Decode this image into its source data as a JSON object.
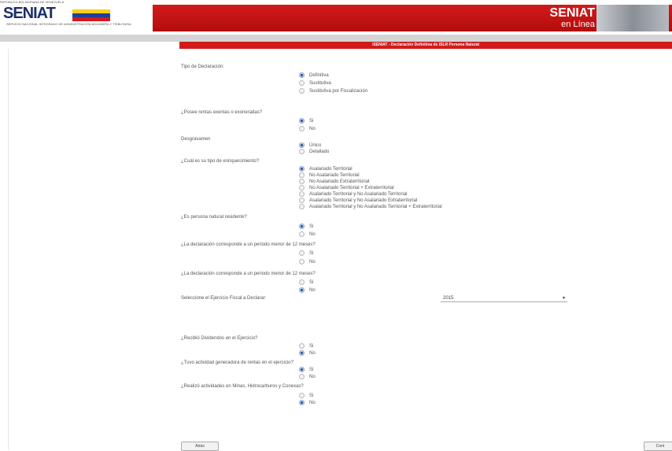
{
  "header": {
    "toptext": "REPÚBLICA BOLIVARIANA DE VENEZUELA",
    "logo": "SENIAT",
    "logo_sub": "SERVICIO NACIONAL INTEGRADO DE ADMINISTRACIÓN ADUANERA Y TRIBUTARIA",
    "brand_line1": "SENIAT",
    "brand_line2": "en Línea"
  },
  "title": "iSENIAT - Declaración Definitiva de ISLR Persona Natural",
  "questions": {
    "tipo": {
      "label": "Tipo de Declaración:",
      "options": [
        "Definitiva",
        "Sustitutiva",
        "Sustitutiva por Fiscalización"
      ],
      "selected": 0
    },
    "exentas": {
      "label": "¿Posee rentas exentas o exoneradas?",
      "options": [
        "Si",
        "No"
      ],
      "selected": 0
    },
    "desgravamen": {
      "label": "Desgravamen",
      "options": [
        "Único",
        "Detallado"
      ],
      "selected": 0
    },
    "enriquecimiento": {
      "label": "¿Cuál es su tipo de enriquecimiento?",
      "options": [
        "Asalariado Territorial",
        "No Asalariado Territorial",
        "No Asalariado Extraterritorial",
        "No Asalariado Territorial + Extraterritorial",
        "Asalariado Territorial y No Asalariado Territorial",
        "Asalariado Territorial y No Asalariado Extraterritorial",
        "Asalariado Territorial y No Asalariado Territorial + Extraterritorial"
      ],
      "selected": 0
    },
    "residente": {
      "label": "¿Es persona natural residente?",
      "options": [
        "Si",
        "No"
      ],
      "selected": 0
    },
    "periodo1": {
      "label": "¿La declaración corresponde a un periodo menor de 12 meses?",
      "options": [
        "Si",
        "No"
      ],
      "selected": -1
    },
    "periodo2": {
      "label": "¿La declaración corresponde a un periodo menor de 12 meses?",
      "options": [
        "Si",
        "No"
      ],
      "selected": 1
    },
    "ejercicio": {
      "label": "Seleccione el Ejercicio Fiscal a Declarar:",
      "value": "2015"
    },
    "dividendos": {
      "label": "¿Recibió Dividendos en el Ejercicio?",
      "options": [
        "Si",
        "No"
      ],
      "selected": 1
    },
    "actividad": {
      "label": "¿Tuvo actividad generadora de rentas en el ejercicio?",
      "options": [
        "Si",
        "No"
      ],
      "selected": 0
    },
    "minas": {
      "label": "¿Realizó actividades en Minas, Hidrocarburos y Conexas?",
      "options": [
        "Si",
        "No"
      ],
      "selected": 1
    }
  },
  "buttons": {
    "back": "Atrás",
    "continue": "Cont"
  }
}
